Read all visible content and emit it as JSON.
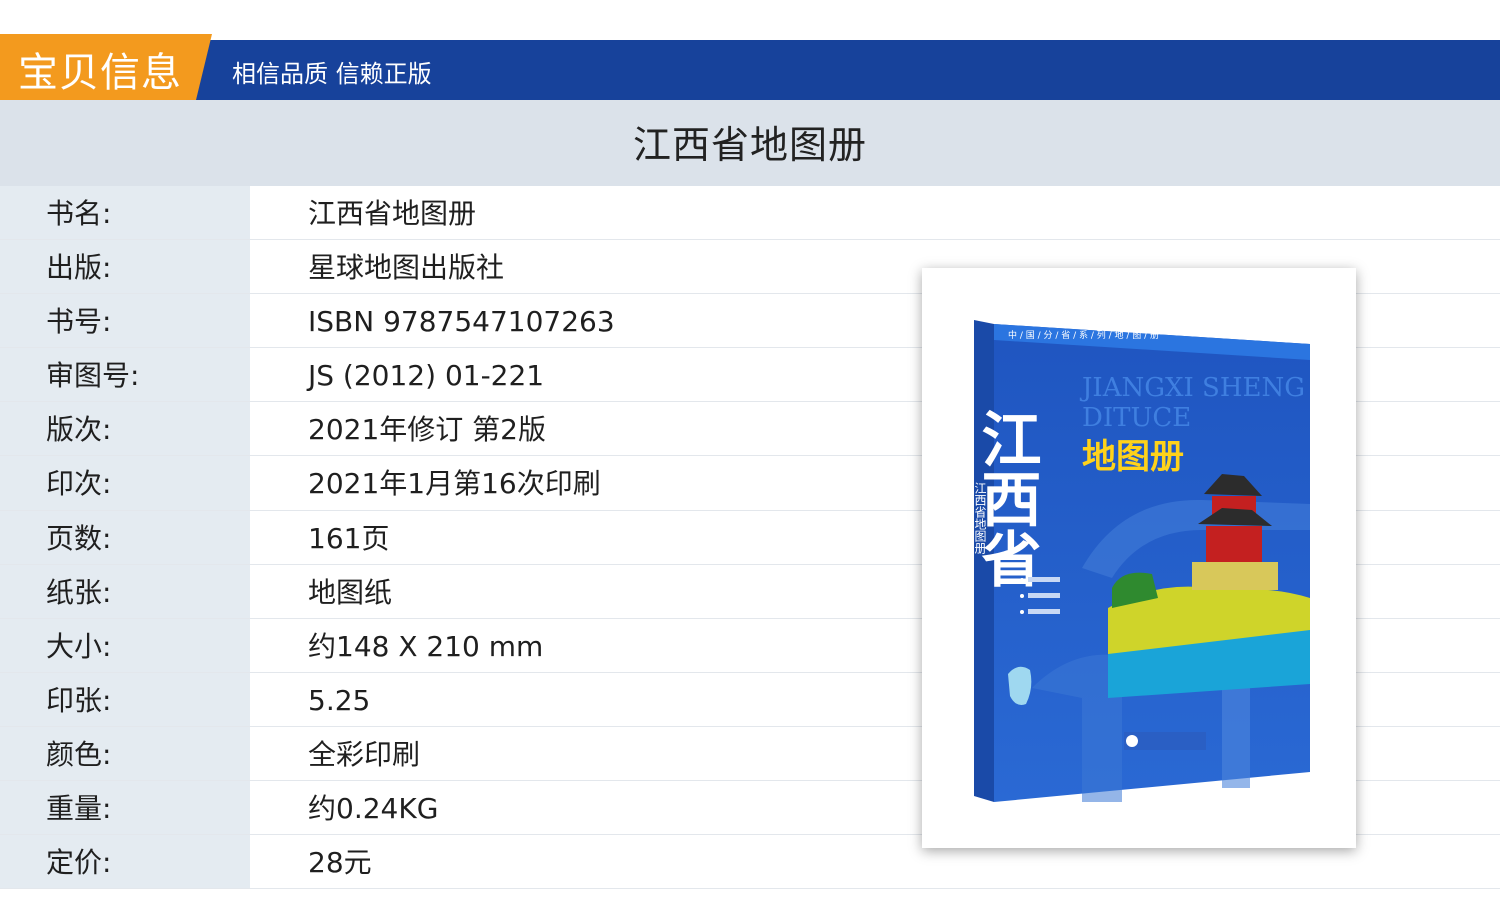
{
  "header": {
    "tab_label": "宝贝信息",
    "slogan": "相信品质 信赖正版"
  },
  "title": "江西省地图册",
  "specs": [
    {
      "label": "书名:",
      "value": "江西省地图册"
    },
    {
      "label": "出版:",
      "value": "星球地图出版社"
    },
    {
      "label": "书号:",
      "value": "ISBN 9787547107263"
    },
    {
      "label": "审图号:",
      "value": "JS (2012) 01-221"
    },
    {
      "label": "版次:",
      "value": "2021年修订 第2版"
    },
    {
      "label": "印次:",
      "value": "2021年1月第16次印刷"
    },
    {
      "label": "页数:",
      "value": "161页"
    },
    {
      "label": "纸张:",
      "value": "地图纸"
    },
    {
      "label": "大小:",
      "value": "约148 X 210 mm"
    },
    {
      "label": "印张:",
      "value": "5.25"
    },
    {
      "label": "颜色:",
      "value": "全彩印刷"
    },
    {
      "label": "重量:",
      "value": "约0.24KG"
    },
    {
      "label": "定价:",
      "value": "28元"
    }
  ],
  "cover": {
    "series_line": "中 / 国 / 分 / 省 / 系 / 列 / 地 / 图 / 册",
    "province": "江西省",
    "pinyin_line1": "JIANGXI SHENG",
    "pinyin_line2": "DITUCE",
    "subtitle": "地图册",
    "spine_text": "江西省地图册",
    "colors": {
      "blue": "#1f5fc8",
      "yellow": "#ffd21a",
      "accent": "#f39a1e",
      "header": "#17429b"
    }
  }
}
